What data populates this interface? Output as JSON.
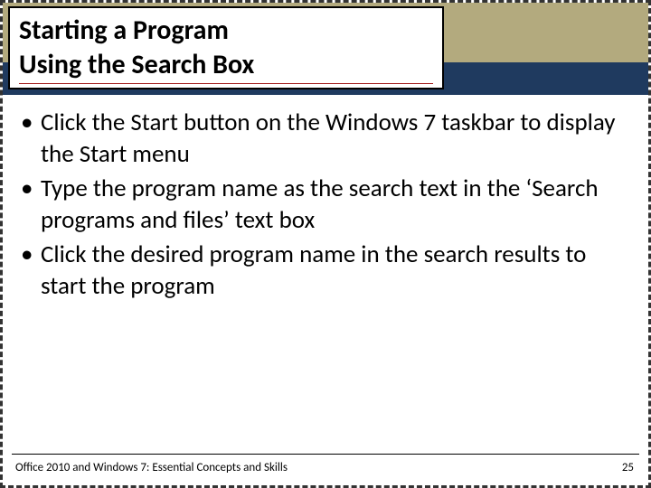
{
  "title": {
    "line1": "Starting a Program",
    "line2": "Using the Search Box"
  },
  "bullets": [
    "Click the Start button on the Windows 7 taskbar to display the Start menu",
    "Type the program name as the search text in the ‘Search programs and files’ text box",
    "Click the desired program name in the search results to start the program"
  ],
  "footer": {
    "left": "Office 2010 and Windows 7: Essential Concepts and Skills",
    "page": "25"
  },
  "colors": {
    "stripe": "#b3aa7e",
    "band": "#1f3a5f",
    "accent": "#a01818"
  }
}
